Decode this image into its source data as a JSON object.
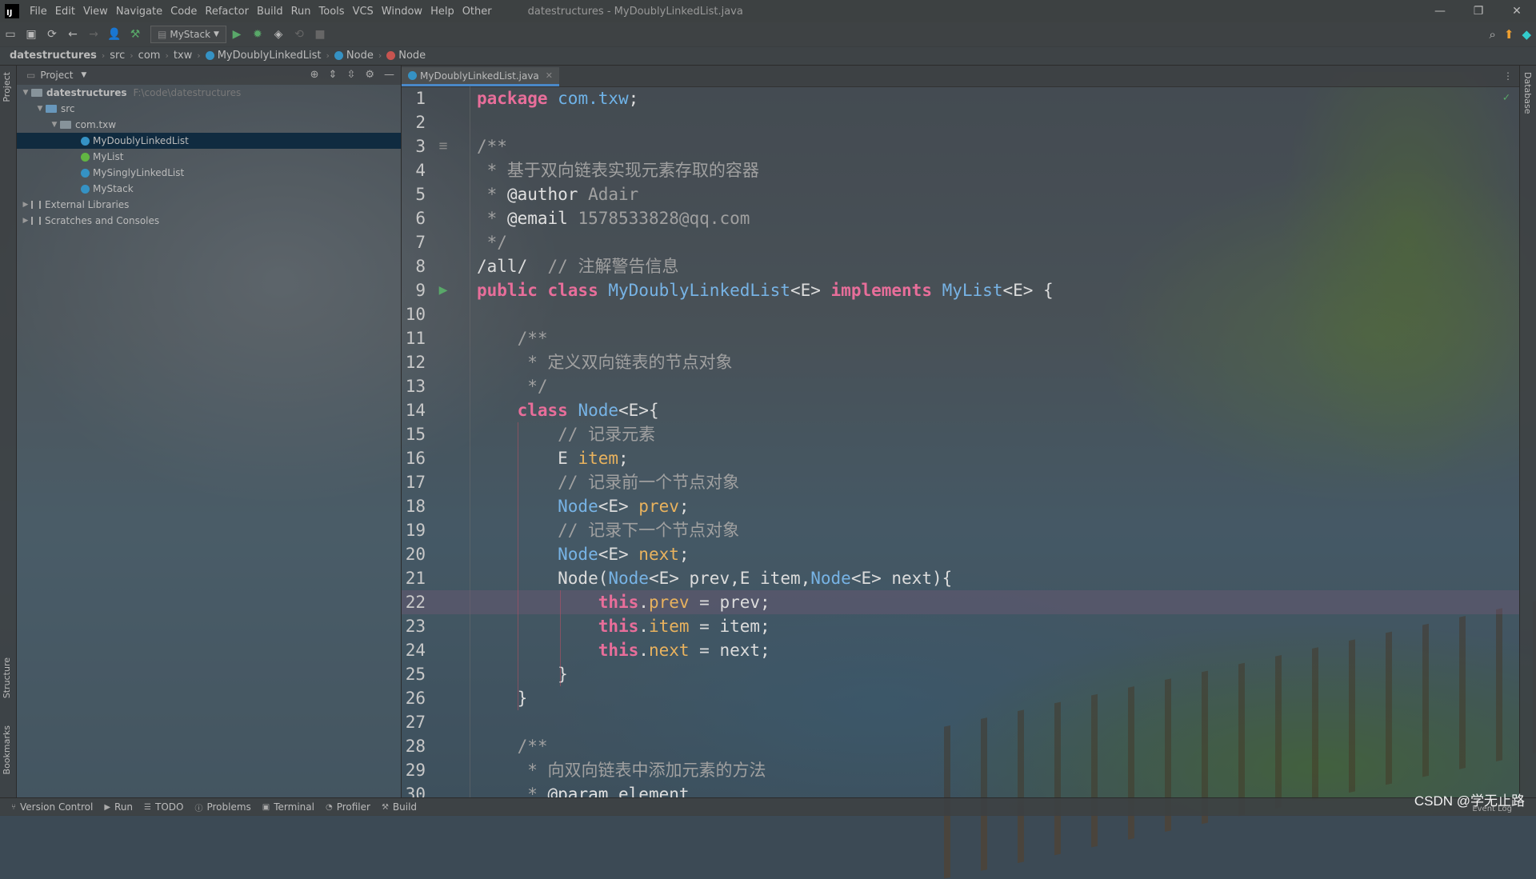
{
  "window": {
    "title": "datestructures - MyDoublyLinkedList.java",
    "logo": "IJ"
  },
  "menu": [
    "File",
    "Edit",
    "View",
    "Navigate",
    "Code",
    "Refactor",
    "Build",
    "Run",
    "Tools",
    "VCS",
    "Window",
    "Help",
    "Other"
  ],
  "toolbar": {
    "run_config": "MyStack"
  },
  "breadcrumbs": [
    "datestructures",
    "src",
    "com",
    "txw",
    "MyDoublyLinkedList",
    "Node",
    "Node"
  ],
  "project": {
    "header": "Project",
    "root": {
      "name": "datestructures",
      "path": "F:\\code\\datestructures"
    },
    "src": "src",
    "package": "com.txw",
    "files": [
      {
        "name": "MyDoublyLinkedList",
        "kind": "class",
        "selected": true
      },
      {
        "name": "MyList",
        "kind": "interface",
        "selected": false
      },
      {
        "name": "MySinglyLinkedList",
        "kind": "class",
        "selected": false
      },
      {
        "name": "MyStack",
        "kind": "class",
        "selected": false
      }
    ],
    "external": "External Libraries",
    "scratches": "Scratches and Consoles"
  },
  "side_tabs": {
    "left_top": "Project",
    "left_structure": "Structure",
    "left_bookmarks": "Bookmarks",
    "right": "Database"
  },
  "editor": {
    "tab": "MyDoublyLinkedList.java",
    "current_line": 22,
    "lines": [
      {
        "n": "1",
        "t": [
          [
            "kw",
            "package "
          ],
          [
            "pk",
            "com.txw"
          ],
          [
            "pl",
            ";"
          ]
        ]
      },
      {
        "n": "2",
        "t": []
      },
      {
        "n": "3",
        "t": [
          [
            "cm",
            "/**"
          ]
        ]
      },
      {
        "n": "4",
        "t": [
          [
            "cm",
            " * 基于双向链表实现元素存取的容器"
          ]
        ]
      },
      {
        "n": "5",
        "t": [
          [
            "cm",
            " * "
          ],
          [
            "tag",
            "@author"
          ],
          [
            "cm",
            " Adair"
          ]
        ]
      },
      {
        "n": "6",
        "t": [
          [
            "cm",
            " * "
          ],
          [
            "tag",
            "@email"
          ],
          [
            "cm",
            " 1578533828@qq.com"
          ]
        ]
      },
      {
        "n": "7",
        "t": [
          [
            "cm",
            " */"
          ]
        ]
      },
      {
        "n": "8",
        "t": [
          [
            "pl",
            "/all/  "
          ],
          [
            "cm",
            "// 注解警告信息"
          ]
        ]
      },
      {
        "n": "9",
        "t": [
          [
            "kw",
            "public class "
          ],
          [
            "cl",
            "MyDoublyLinkedList"
          ],
          [
            "pl",
            "<E> "
          ],
          [
            "kw",
            "implements "
          ],
          [
            "cl",
            "MyList"
          ],
          [
            "pl",
            "<E> {"
          ]
        ]
      },
      {
        "n": "10",
        "t": []
      },
      {
        "n": "11",
        "t": [
          [
            "cm",
            "    /**"
          ]
        ]
      },
      {
        "n": "12",
        "t": [
          [
            "cm",
            "     * 定义双向链表的节点对象"
          ]
        ]
      },
      {
        "n": "13",
        "t": [
          [
            "cm",
            "     */"
          ]
        ]
      },
      {
        "n": "14",
        "t": [
          [
            "kw",
            "    class "
          ],
          [
            "cl",
            "Node"
          ],
          [
            "pl",
            "<E>{"
          ]
        ]
      },
      {
        "n": "15",
        "t": [
          [
            "cm",
            "        // 记录元素"
          ]
        ]
      },
      {
        "n": "16",
        "t": [
          [
            "pl",
            "        E "
          ],
          [
            "fd",
            "item"
          ],
          [
            "pl",
            ";"
          ]
        ]
      },
      {
        "n": "17",
        "t": [
          [
            "cm",
            "        // 记录前一个节点对象"
          ]
        ]
      },
      {
        "n": "18",
        "t": [
          [
            "cl",
            "        Node"
          ],
          [
            "pl",
            "<E> "
          ],
          [
            "fd",
            "prev"
          ],
          [
            "pl",
            ";"
          ]
        ]
      },
      {
        "n": "19",
        "t": [
          [
            "cm",
            "        // 记录下一个节点对象"
          ]
        ]
      },
      {
        "n": "20",
        "t": [
          [
            "cl",
            "        Node"
          ],
          [
            "pl",
            "<E> "
          ],
          [
            "fd",
            "next"
          ],
          [
            "pl",
            ";"
          ]
        ]
      },
      {
        "n": "21",
        "t": [
          [
            "pl",
            "        Node("
          ],
          [
            "cl",
            "Node"
          ],
          [
            "pl",
            "<E> prev,E item,"
          ],
          [
            "cl",
            "Node"
          ],
          [
            "pl",
            "<E> next){"
          ]
        ]
      },
      {
        "n": "22",
        "t": [
          [
            "kw",
            "            this"
          ],
          [
            "pl",
            "."
          ],
          [
            "fd",
            "prev"
          ],
          [
            "pl",
            " = prev;"
          ]
        ]
      },
      {
        "n": "23",
        "t": [
          [
            "kw",
            "            this"
          ],
          [
            "pl",
            "."
          ],
          [
            "fd",
            "item"
          ],
          [
            "pl",
            " = item;"
          ]
        ]
      },
      {
        "n": "24",
        "t": [
          [
            "kw",
            "            this"
          ],
          [
            "pl",
            "."
          ],
          [
            "fd",
            "next"
          ],
          [
            "pl",
            " = next;"
          ]
        ]
      },
      {
        "n": "25",
        "t": [
          [
            "pl",
            "        }"
          ]
        ]
      },
      {
        "n": "26",
        "t": [
          [
            "pl",
            "    }"
          ]
        ]
      },
      {
        "n": "27",
        "t": []
      },
      {
        "n": "28",
        "t": [
          [
            "cm",
            "    /**"
          ]
        ]
      },
      {
        "n": "29",
        "t": [
          [
            "cm",
            "     * 向双向链表中添加元素的方法"
          ]
        ]
      },
      {
        "n": "30",
        "t": [
          [
            "cm",
            "     * "
          ],
          [
            "tag",
            "@param"
          ],
          [
            "pl",
            " element"
          ]
        ]
      }
    ]
  },
  "statusbar": [
    "Version Control",
    "Run",
    "TODO",
    "Problems",
    "Terminal",
    "Profiler",
    "Build"
  ],
  "watermark": "CSDN @学无止路",
  "event_log": "Event Log"
}
